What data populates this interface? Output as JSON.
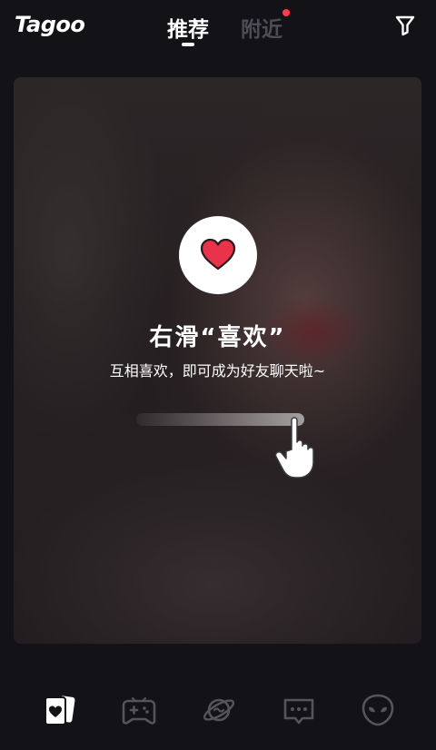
{
  "header": {
    "logo": "Tagoo",
    "tabs": [
      {
        "label": "推荐",
        "active": true
      },
      {
        "label": "附近",
        "active": false,
        "has_dot": true
      }
    ],
    "filter_icon": "filter-icon"
  },
  "card": {
    "heart_icon": "heart-icon",
    "title": "右滑“喜欢”",
    "subtitle": "互相喜欢，即可成为好友聊天啦~",
    "hand_icon": "hand-pointer-icon"
  },
  "bottom_nav": {
    "items": [
      {
        "icon": "cards-icon",
        "active": true
      },
      {
        "icon": "gamepad-icon",
        "active": false
      },
      {
        "icon": "planet-icon",
        "active": false
      },
      {
        "icon": "message-icon",
        "active": false
      },
      {
        "icon": "alien-icon",
        "active": false
      }
    ]
  },
  "colors": {
    "background": "#131217",
    "heart_red": "#e8334a",
    "nearby_dot": "#ff3b4e",
    "inactive_tab": "#4e4d55",
    "inactive_icon": "#55545c"
  }
}
